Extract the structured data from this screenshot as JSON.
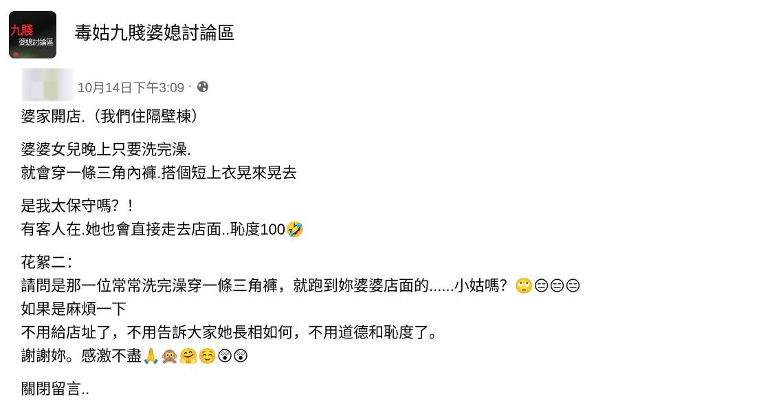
{
  "group": {
    "name": "毒姑九賤婆媳討論區",
    "avatar_text_main": "九賤",
    "avatar_text_sub": "婆媳討論區"
  },
  "post": {
    "timestamp": "10月14日下午3:09",
    "separator": "·",
    "privacy_icon": "globe-icon",
    "paragraphs": [
      [
        "婆家開店.（我們住隔壁棟）"
      ],
      [
        "婆婆女兒晚上只要洗完澡.",
        "就會穿一條三角內褲.搭個短上衣晃來晃去"
      ],
      [
        "是我太保守嗎？！",
        "有客人在.她也會直接走去店面..恥度100🤣"
      ],
      [
        "花絮二：",
        "請問是那一位常常洗完澡穿一條三角褲，就跑到妳婆婆店面的......小姑嗎？🙄😑😑😑",
        "如果是麻煩一下",
        "不用給店址了，不用告訴大家她長相如何，不用道德和恥度了。",
        "謝謝妳。感激不盡🙏🙊🤗☺️😲😲"
      ],
      [
        "關閉留言.."
      ]
    ]
  },
  "colors": {
    "text_primary": "#050505",
    "text_secondary": "#65676b",
    "background": "#ffffff"
  }
}
